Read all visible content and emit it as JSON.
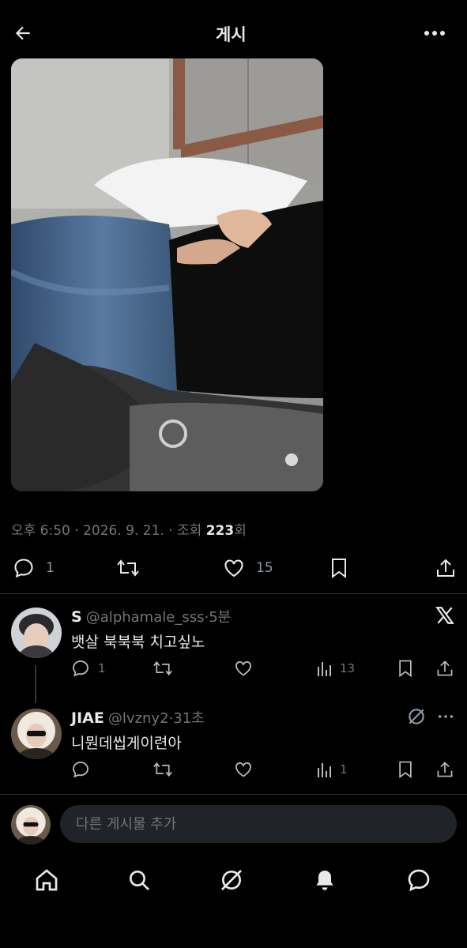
{
  "header": {
    "title": "게시",
    "back_icon": "arrow-left-icon",
    "more_icon": "more-dots-icon"
  },
  "post": {
    "time": "오후 6:50",
    "date": "2026. 9. 21.",
    "views_label_pre": "조회",
    "views": "223",
    "views_label_post": "회",
    "sep": "·",
    "replies": "1",
    "likes": "15"
  },
  "reply1": {
    "name": "S",
    "handle": "@alphamale_sss",
    "time": "5분",
    "text": "뱃살 북북북 치고싶노",
    "replies": "1",
    "views": "13",
    "badge": "x-logo-icon"
  },
  "reply2": {
    "name": "JIAE",
    "handle": "@lvzny2",
    "time": "31초",
    "text": "니뭔데씹게이련아",
    "views": "1"
  },
  "compose": {
    "placeholder": "다른 게시물 추가"
  },
  "nav": [
    "home",
    "search",
    "grok",
    "notifications",
    "messages"
  ]
}
